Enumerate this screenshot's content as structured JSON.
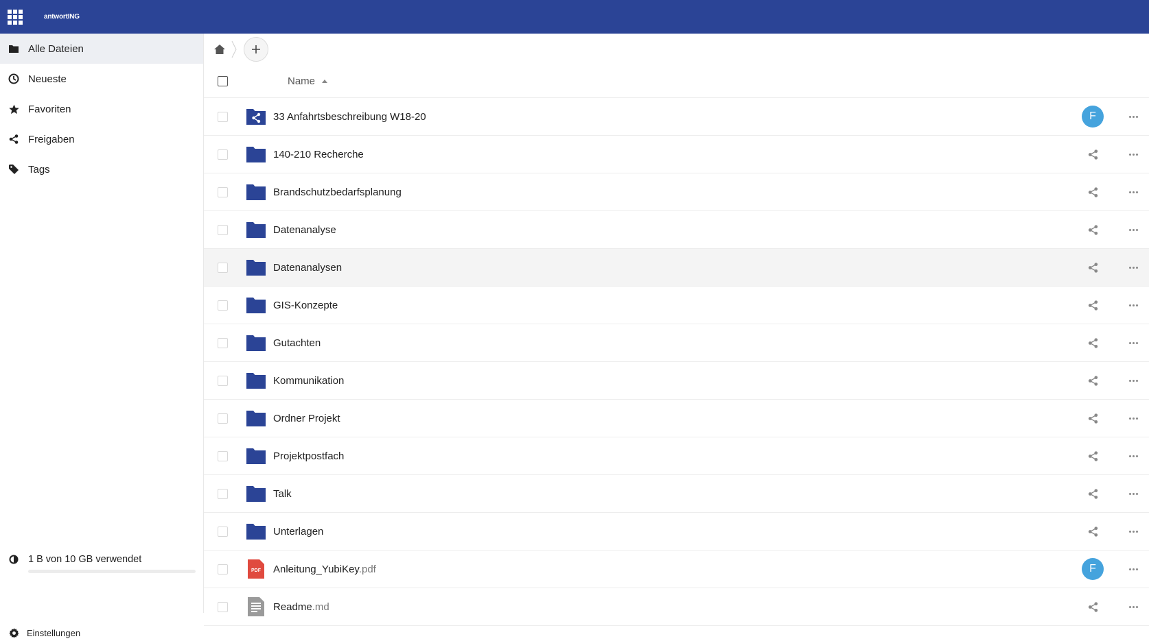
{
  "header": {
    "app_name": "antwortING",
    "apps_icon": "apps-grid-icon",
    "color": "#2b4496"
  },
  "sidebar": {
    "items": [
      {
        "label": "Alle Dateien",
        "icon": "folder-icon",
        "active": true
      },
      {
        "label": "Neueste",
        "icon": "clock-icon",
        "active": false
      },
      {
        "label": "Favoriten",
        "icon": "star-icon",
        "active": false
      },
      {
        "label": "Freigaben",
        "icon": "share-icon",
        "active": false
      },
      {
        "label": "Tags",
        "icon": "tag-icon",
        "active": false
      }
    ],
    "quota": {
      "text": "1 B von 10 GB verwendet",
      "used_fraction": 0.0
    },
    "settings_label": "Einstellungen"
  },
  "breadcrumb": {
    "home_icon": "home-icon",
    "add_icon": "plus-icon"
  },
  "list": {
    "column_name": "Name",
    "sort": "ascending",
    "rows": [
      {
        "name": "33 Anfahrtsbeschreibung W18-20",
        "ext": "",
        "type": "shared-folder",
        "shared_with": "F"
      },
      {
        "name": "140-210 Recherche",
        "ext": "",
        "type": "folder"
      },
      {
        "name": "Brandschutzbedarfsplanung",
        "ext": "",
        "type": "folder"
      },
      {
        "name": "Datenanalyse",
        "ext": "",
        "type": "folder"
      },
      {
        "name": "Datenanalysen",
        "ext": "",
        "type": "folder",
        "hover": true
      },
      {
        "name": "GIS-Konzepte",
        "ext": "",
        "type": "folder"
      },
      {
        "name": "Gutachten",
        "ext": "",
        "type": "folder"
      },
      {
        "name": "Kommunikation",
        "ext": "",
        "type": "folder"
      },
      {
        "name": "Ordner Projekt",
        "ext": "",
        "type": "folder"
      },
      {
        "name": "Projektpostfach",
        "ext": "",
        "type": "folder"
      },
      {
        "name": "Talk",
        "ext": "",
        "type": "folder"
      },
      {
        "name": "Unterlagen",
        "ext": "",
        "type": "folder"
      },
      {
        "name": "Anleitung_YubiKey",
        "ext": ".pdf",
        "type": "pdf",
        "shared_with": "F"
      },
      {
        "name": "Readme",
        "ext": ".md",
        "type": "text"
      }
    ]
  },
  "colors": {
    "folder": "#2b4496",
    "avatar": "#45a3dd",
    "pdf": "#e04a3f",
    "pdf_label": "PDF"
  }
}
